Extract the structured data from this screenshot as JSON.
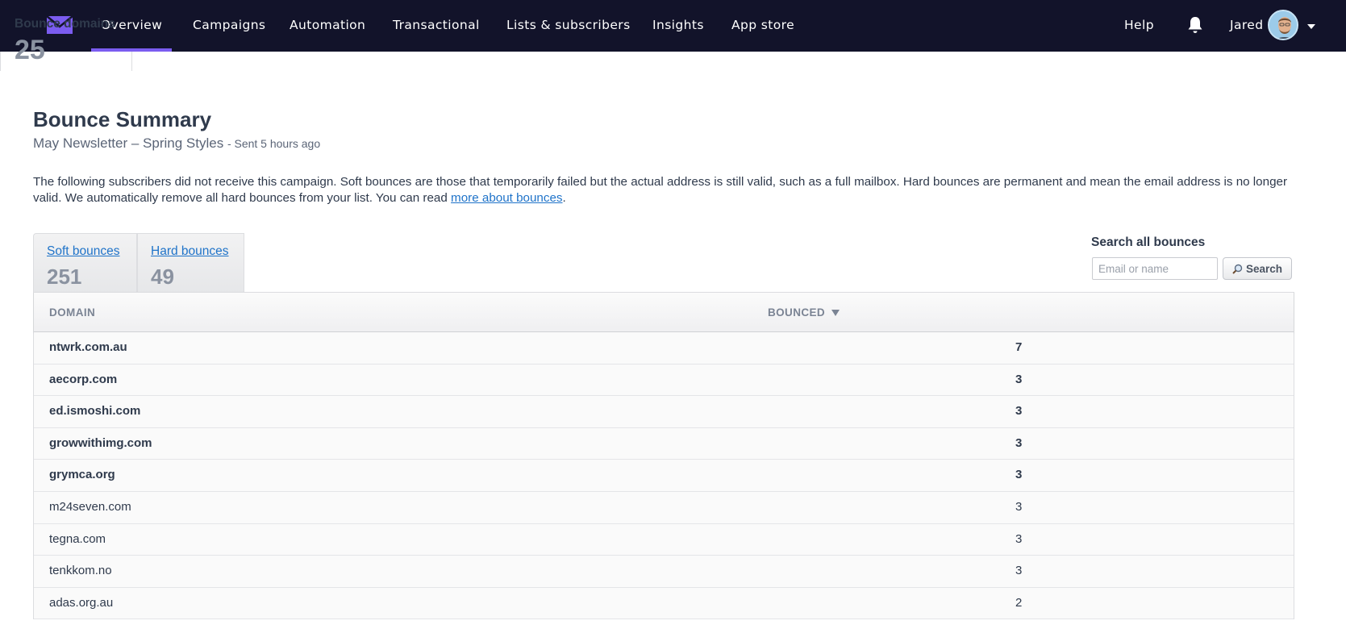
{
  "nav": {
    "items": [
      {
        "label": "Overview",
        "active": true
      },
      {
        "label": "Campaigns"
      },
      {
        "label": "Automation"
      },
      {
        "label": "Transactional"
      },
      {
        "label": "Lists & subscribers"
      },
      {
        "label": "Insights"
      },
      {
        "label": "App store"
      }
    ],
    "help": "Help",
    "user_name": "Jared",
    "accent_color": "#7b5cf0"
  },
  "page": {
    "title": "Bounce Summary",
    "campaign": "May Newsletter – Spring Styles",
    "sent": "- Sent 5 hours ago",
    "description": "The following subscribers did not receive this campaign. Soft bounces are those that temporarily failed but the actual address is still valid, such as a full mailbox. Hard bounces are permanent and mean the email address is no longer valid. We automatically remove all hard bounces from your list. You can read ",
    "description_link": "more about bounces",
    "description_end": "."
  },
  "tabs": {
    "soft": {
      "label": "Soft bounces",
      "count": "251"
    },
    "hard": {
      "label": "Hard bounces",
      "count": "49"
    },
    "domains": {
      "label": "Bounce domains",
      "count": "25",
      "active": true
    }
  },
  "search": {
    "label": "Search all bounces",
    "placeholder": "Email or name",
    "button": "Search"
  },
  "table": {
    "columns": {
      "domain": "DOMAIN",
      "bounced": "BOUNCED"
    },
    "sort": "descending",
    "rows": [
      {
        "domain": "ntwrk.com.au",
        "bounced": "7",
        "bold": true
      },
      {
        "domain": "aecorp.com",
        "bounced": "3",
        "bold": true
      },
      {
        "domain": "ed.ismoshi.com",
        "bounced": "3",
        "bold": true
      },
      {
        "domain": "growwithimg.com",
        "bounced": "3",
        "bold": true
      },
      {
        "domain": "grymca.org",
        "bounced": "3",
        "bold": true
      },
      {
        "domain": "m24seven.com",
        "bounced": "3",
        "bold": false
      },
      {
        "domain": "tegna.com",
        "bounced": "3",
        "bold": false
      },
      {
        "domain": "tenkkom.no",
        "bounced": "3",
        "bold": false
      },
      {
        "domain": "adas.org.au",
        "bounced": "2",
        "bold": false
      }
    ]
  }
}
